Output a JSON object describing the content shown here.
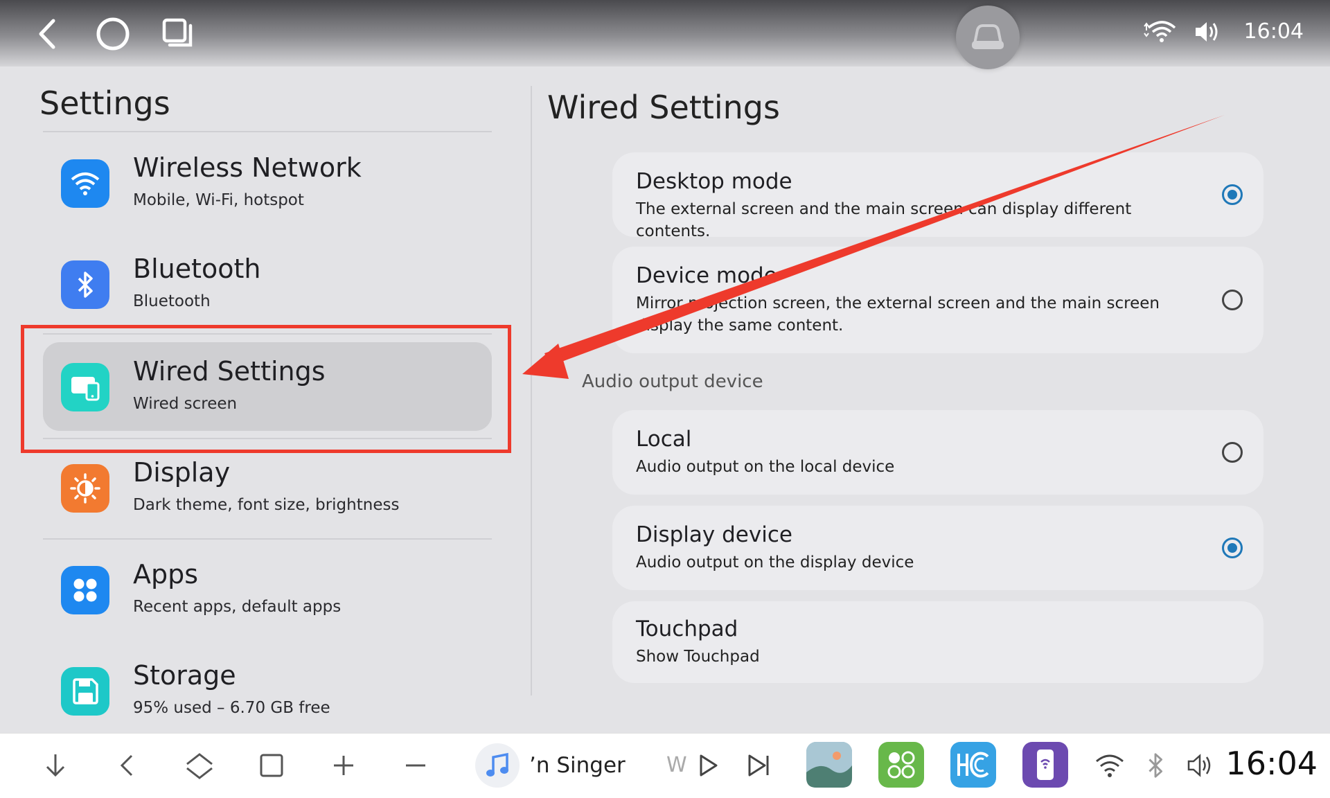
{
  "status_bar": {
    "time": "16:04"
  },
  "settings": {
    "title": "Settings",
    "items": [
      {
        "key": "wireless",
        "title": "Wireless Network",
        "subtitle": "Mobile, Wi-Fi, hotspot",
        "icon": "wifi-icon",
        "color": "#1e88f0"
      },
      {
        "key": "bluetooth",
        "title": "Bluetooth",
        "subtitle": "Bluetooth",
        "icon": "bluetooth-icon",
        "color": "#3f7df0"
      },
      {
        "key": "wired",
        "title": "Wired Settings",
        "subtitle": "Wired screen",
        "icon": "wired-screen-icon",
        "color": "#22d3c5",
        "selected": true
      },
      {
        "key": "display",
        "title": "Display",
        "subtitle": "Dark theme, font size, brightness",
        "icon": "brightness-icon",
        "color": "#f27a30"
      },
      {
        "key": "apps",
        "title": "Apps",
        "subtitle": "Recent apps, default apps",
        "icon": "apps-grid-icon",
        "color": "#1e88f0"
      },
      {
        "key": "storage",
        "title": "Storage",
        "subtitle": "95% used – 6.70 GB free",
        "icon": "save-disk-icon",
        "color": "#1ec8c8"
      }
    ]
  },
  "wired": {
    "title": "Wired Settings",
    "desktop_mode": {
      "title": "Desktop mode",
      "desc": "The external screen and the main screen can display different contents.",
      "selected": true
    },
    "device_mode": {
      "title": "Device mode",
      "desc": "Mirror projection screen, the external screen and the main screen display the same content.",
      "selected": false
    },
    "audio_header": "Audio output device",
    "local": {
      "title": "Local",
      "desc": "Audio output on the local device",
      "selected": false
    },
    "display_device": {
      "title": "Display device",
      "desc": "Audio output on the display device",
      "selected": true
    },
    "touchpad": {
      "title": "Touchpad",
      "desc": "Show Touchpad"
    }
  },
  "dock": {
    "song": "’n Singer",
    "song_next": "W",
    "time": "16:04"
  },
  "colors": {
    "accent": "#1f78b8",
    "highlight": "#ee3a2c"
  }
}
